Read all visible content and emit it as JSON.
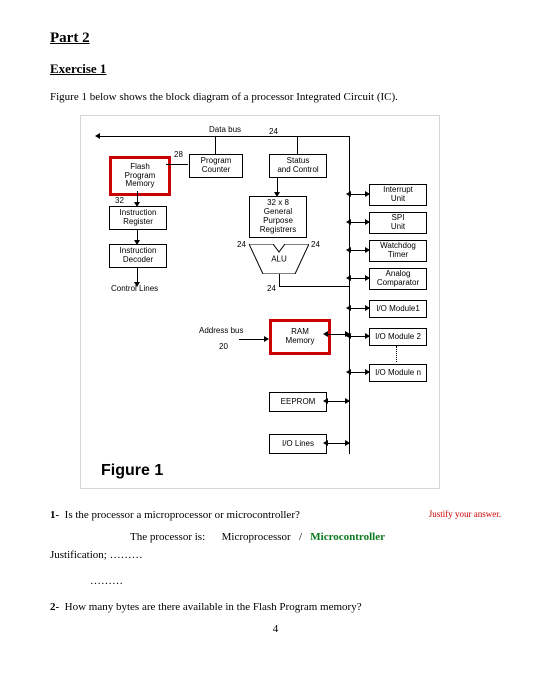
{
  "part_title": "Part 2",
  "exercise_title": "Exercise 1",
  "intro": "Figure 1 below shows the block diagram of a processor Integrated Circuit (IC).",
  "diagram": {
    "data_bus_label": "Data bus",
    "address_bus_label": "Address bus",
    "n24": "24",
    "n28": "28",
    "n32": "32",
    "n20": "20",
    "flash": "Flash\nProgram\nMemory",
    "pc": "Program\nCounter",
    "status": "Status\nand Control",
    "instr_reg": "Instruction\nRegister",
    "gpr": "32 x 8\nGeneral\nPurpose\nRegistrers",
    "interrupt": "Interrupt\nUnit",
    "spi": "SPI\nUnit",
    "watchdog": "Watchdog\nTimer",
    "analog": "Analog\nComparator",
    "io1": "I/O Module1",
    "io2": "I/O Module 2",
    "ion": "I/O Module n",
    "instr_dec": "Instruction\nDecoder",
    "control_lines": "Control Lines",
    "alu": "ALU",
    "ram": "RAM\nMemory",
    "eeprom": "EEPROM",
    "io_lines": "I/O Lines",
    "fig_caption": "Figure 1"
  },
  "q1": {
    "num": "1-",
    "text": "Is the processor a microprocessor or microcontroller?",
    "hint": "Justify your answer.",
    "answer_prefix": "The processor is:",
    "opt1": "Microprocessor",
    "sep": "/",
    "opt2": "Microcontroller",
    "justification_label": "Justification; ………",
    "dots": "………"
  },
  "q2": {
    "num": "2-",
    "text": "How many bytes are there available in the Flash Program memory?"
  },
  "page_number": "4"
}
